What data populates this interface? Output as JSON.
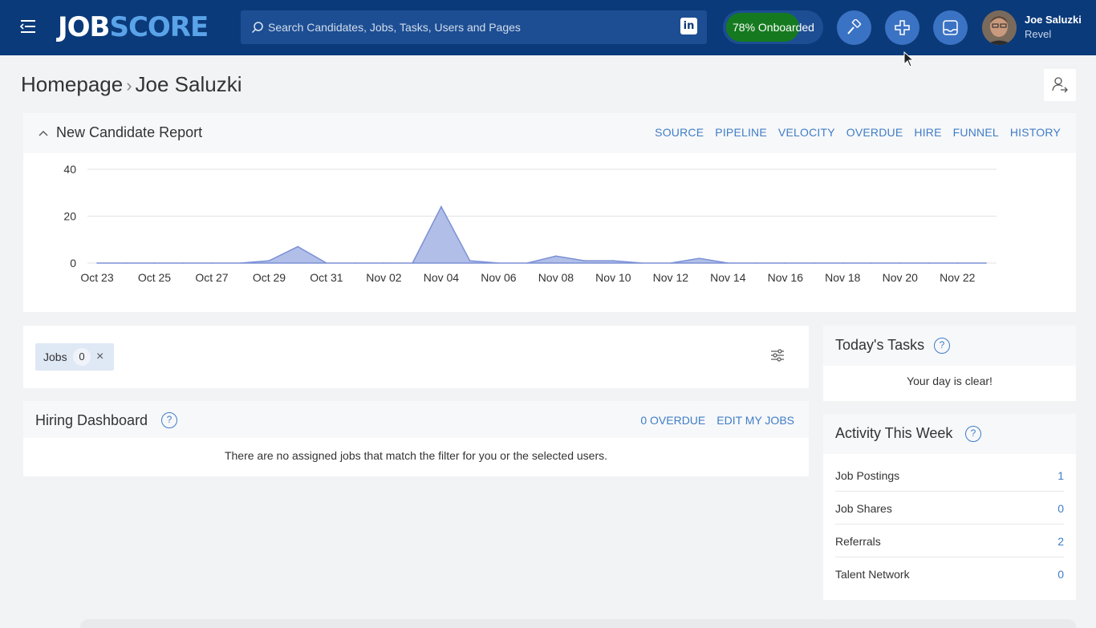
{
  "header": {
    "logo_part1": "JOB",
    "logo_part2": "SCORE",
    "search_placeholder": "Search Candidates, Jobs, Tasks, Users and Pages",
    "linkedin_icon": "linkedin-icon",
    "onboarded": "78% Onboarded",
    "onboarded_progress": 0.78,
    "buttons": [
      "hammer-icon",
      "plus-icon",
      "inbox-icon"
    ],
    "user": {
      "name": "Joe Saluzki",
      "org": "Revel"
    }
  },
  "breadcrumb": {
    "root": "Homepage",
    "current": "Joe Saluzki"
  },
  "report": {
    "title": "New Candidate Report",
    "tabs": [
      "SOURCE",
      "PIPELINE",
      "VELOCITY",
      "OVERDUE",
      "HIRE",
      "FUNNEL",
      "HISTORY"
    ]
  },
  "chart_data": {
    "type": "area",
    "x": [
      "Oct 23",
      "Oct 24",
      "Oct 25",
      "Oct 26",
      "Oct 27",
      "Oct 28",
      "Oct 29",
      "Oct 30",
      "Oct 31",
      "Nov 01",
      "Nov 02",
      "Nov 03",
      "Nov 04",
      "Nov 05",
      "Nov 06",
      "Nov 07",
      "Nov 08",
      "Nov 09",
      "Nov 10",
      "Nov 11",
      "Nov 12",
      "Nov 13",
      "Nov 14",
      "Nov 15",
      "Nov 16",
      "Nov 17",
      "Nov 18",
      "Nov 19",
      "Nov 20",
      "Nov 21",
      "Nov 22",
      "Nov 23"
    ],
    "values": [
      0,
      0,
      0,
      0,
      0,
      0,
      1,
      7,
      0,
      0,
      0,
      0,
      24,
      1,
      0,
      0,
      3,
      1,
      1,
      0,
      0,
      2,
      0,
      0,
      0,
      0,
      0,
      0,
      0,
      0,
      0,
      0
    ],
    "tick_labels": [
      "Oct 23",
      "Oct 25",
      "Oct 27",
      "Oct 29",
      "Oct 31",
      "Nov 02",
      "Nov 04",
      "Nov 06",
      "Nov 08",
      "Nov 10",
      "Nov 12",
      "Nov 14",
      "Nov 16",
      "Nov 18",
      "Nov 20",
      "Nov 22"
    ],
    "y_ticks": [
      0,
      20,
      40
    ],
    "ylim": [
      0,
      40
    ],
    "grid": true,
    "fill_color": "#a9b8e6",
    "line_color": "#7b90d6"
  },
  "jobs_filter": {
    "label": "Jobs",
    "count": "0",
    "remove": "×"
  },
  "hiring": {
    "title": "Hiring Dashboard",
    "overdue_link": "0 OVERDUE",
    "edit_link": "EDIT MY JOBS",
    "empty": "There are no assigned jobs that match the filter for you or the selected users."
  },
  "tasks": {
    "title": "Today's Tasks",
    "empty": "Your day is clear!"
  },
  "activity": {
    "title": "Activity This Week",
    "rows": [
      {
        "label": "Job Postings",
        "value": "1"
      },
      {
        "label": "Job Shares",
        "value": "0"
      },
      {
        "label": "Referrals",
        "value": "2"
      },
      {
        "label": "Talent Network",
        "value": "0"
      }
    ]
  },
  "colors": {
    "header_bg": "#0b3a7a",
    "link": "#3f7dc6",
    "onboard": "#157a1f",
    "accent_button": "#3b73c4"
  }
}
